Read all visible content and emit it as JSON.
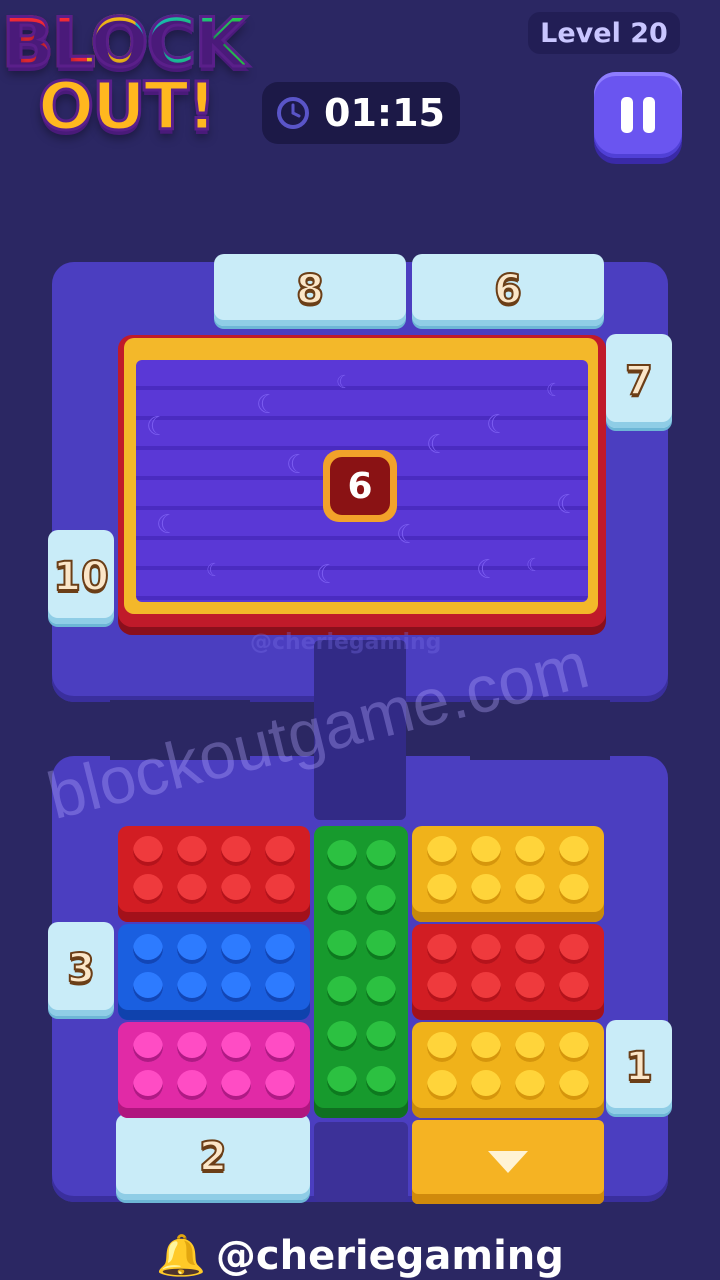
{
  "header": {
    "logo_line1": "BLOCK",
    "logo_line2": "OUT!",
    "level": "Level 20",
    "timer": "01:15"
  },
  "board": {
    "gates": {
      "top_left": "8",
      "top_right": "6",
      "right_top": "7",
      "left_mid": "10",
      "left_lower": "3",
      "right_lower": "1",
      "bottom": "2"
    },
    "blocker_counter": "6"
  },
  "blocks": [
    {
      "color": "red",
      "label": "red-block"
    },
    {
      "color": "blue",
      "label": "blue-block"
    },
    {
      "color": "pink",
      "label": "pink-block"
    },
    {
      "color": "green",
      "label": "green-block"
    },
    {
      "color": "yellow",
      "label": "yellow-block-top"
    },
    {
      "color": "red",
      "label": "red-block-right"
    },
    {
      "color": "yellow",
      "label": "yellow-block-bottom"
    }
  ],
  "colors": {
    "background": "#2b2763",
    "track": "#4b3ec0",
    "red": "#d21d23",
    "blue": "#1a5fe0",
    "pink": "#e12aa6",
    "green": "#179a2d",
    "yellow": "#f0b21a",
    "gate_ice": "#c9ecf8"
  },
  "watermark": {
    "site": "blockoutgame.com",
    "handle_faint": "@cheriegaming"
  },
  "footer": {
    "handle": "@cheriegaming"
  }
}
